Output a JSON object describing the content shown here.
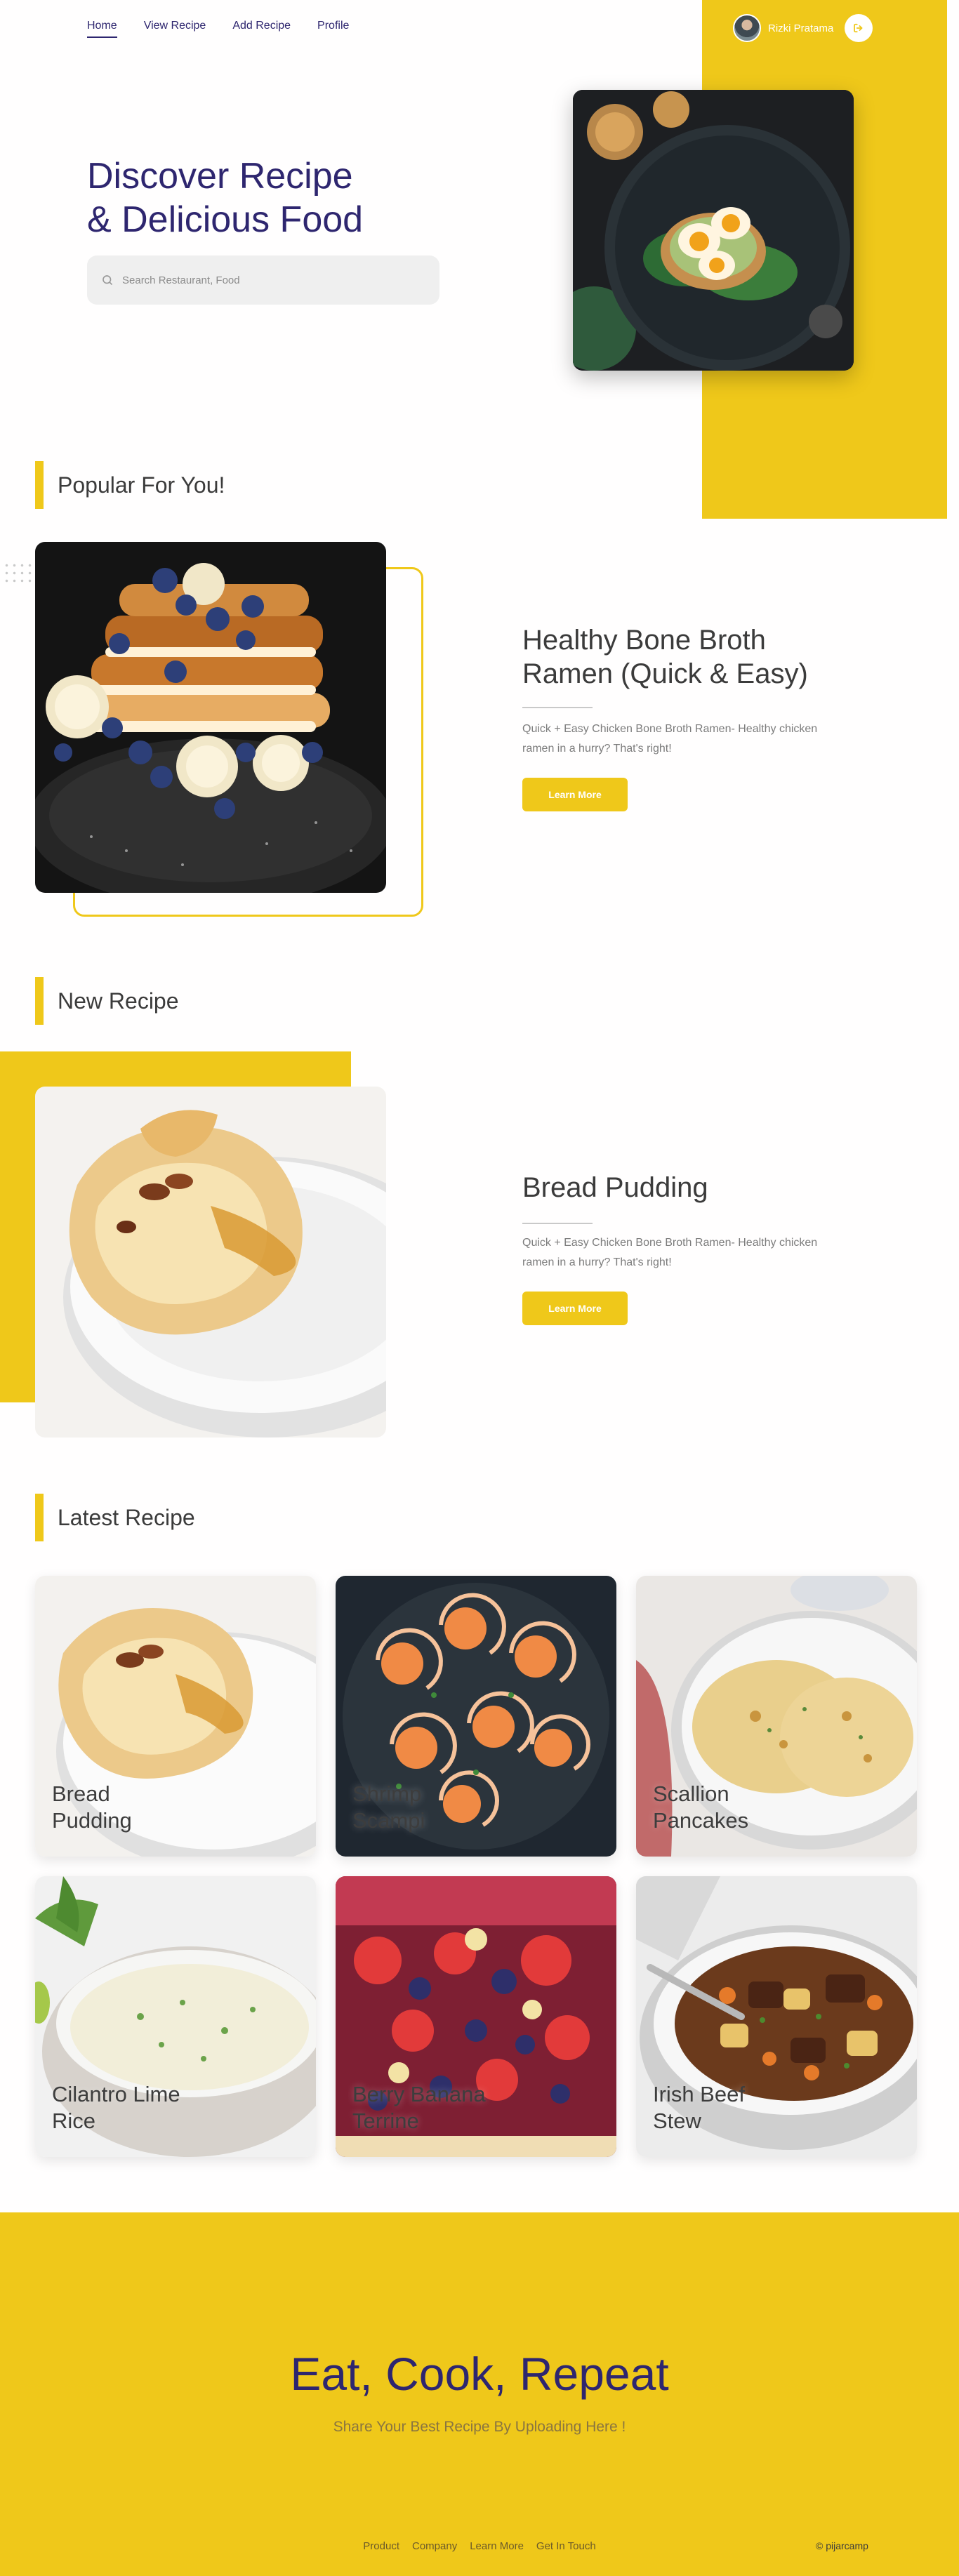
{
  "nav": {
    "items": [
      {
        "label": "Home",
        "active": true
      },
      {
        "label": "View Recipe",
        "active": false
      },
      {
        "label": "Add Recipe",
        "active": false
      },
      {
        "label": "Profile",
        "active": false
      }
    ],
    "user_name": "Rizki Pratama"
  },
  "hero": {
    "title_line1": "Discover Recipe",
    "title_line2": "& Delicious Food",
    "search_placeholder": "Search Restaurant, Food"
  },
  "popular": {
    "heading": "Popular For You!",
    "title": "Healthy Bone Broth Ramen (Quick & Easy)",
    "description": "Quick + Easy Chicken Bone Broth Ramen- Healthy chicken ramen in a hurry? That's right!",
    "button_label": "Learn More"
  },
  "new_recipe": {
    "heading": "New Recipe",
    "title": "Bread Pudding",
    "description": "Quick + Easy Chicken Bone Broth Ramen- Healthy chicken ramen in a hurry? That's right!",
    "button_label": "Learn More"
  },
  "latest": {
    "heading": "Latest Recipe",
    "cards": [
      {
        "title": "Bread Pudding"
      },
      {
        "title": "Shrimp Scampi"
      },
      {
        "title": "Scallion Pancakes"
      },
      {
        "title": "Cilantro Lime Rice"
      },
      {
        "title": "Berry Banana Terrine"
      },
      {
        "title": "Irish Beef Stew"
      }
    ]
  },
  "footer": {
    "title": "Eat, Cook, Repeat",
    "subtitle": "Share Your Best Recipe By Uploading Here !",
    "links": [
      "Product",
      "Company",
      "Learn More",
      "Get In Touch"
    ],
    "copyright": "© pijarcamp"
  },
  "colors": {
    "accent": "#efc81a",
    "brand": "#2e266f"
  }
}
